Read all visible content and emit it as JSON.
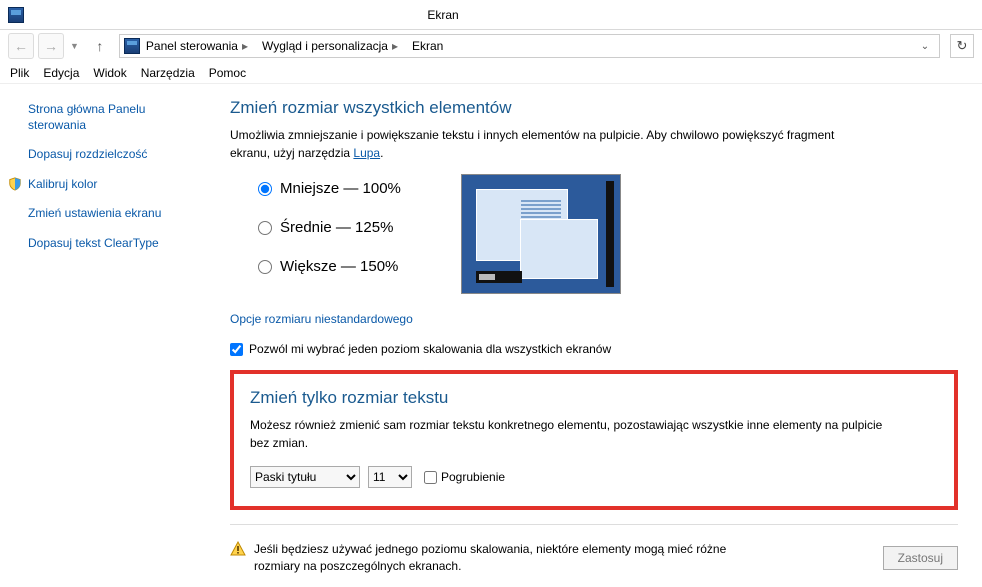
{
  "window": {
    "title": "Ekran"
  },
  "nav": {
    "crumbs": [
      "Panel sterowania",
      "Wygląd i personalizacja",
      "Ekran"
    ]
  },
  "menu": {
    "items": [
      "Plik",
      "Edycja",
      "Widok",
      "Narzędzia",
      "Pomoc"
    ]
  },
  "sidebar": {
    "items": [
      {
        "label": "Strona główna Panelu sterowania"
      },
      {
        "label": "Dopasuj rozdzielczość"
      },
      {
        "label": "Kalibruj kolor",
        "shield": true
      },
      {
        "label": "Zmień ustawienia ekranu"
      },
      {
        "label": "Dopasuj tekst ClearType"
      }
    ]
  },
  "main": {
    "section1_title": "Zmień rozmiar wszystkich elementów",
    "section1_desc_1": "Umożliwia zmniejszanie i powiększanie tekstu i innych elementów na pulpicie. Aby chwilowo powiększyć fragment ekranu, użyj narzędzia ",
    "section1_desc_link": "Lupa",
    "section1_desc_2": ".",
    "radios": [
      {
        "label": "Mniejsze — 100%",
        "checked": true
      },
      {
        "label": "Średnie — 125%",
        "checked": false
      },
      {
        "label": "Większe — 150%",
        "checked": false
      }
    ],
    "custom_link": "Opcje rozmiaru niestandardowego",
    "scaling_checkbox": {
      "label": "Pozwól mi wybrać jeden poziom skalowania dla wszystkich ekranów",
      "checked": true
    },
    "section2_title": "Zmień tylko rozmiar tekstu",
    "section2_desc": "Możesz również zmienić sam rozmiar tekstu konkretnego elementu, pozostawiając wszystkie inne elementy na pulpicie bez zmian.",
    "element_select": {
      "value": "Paski tytułu"
    },
    "size_select": {
      "value": "11"
    },
    "bold_checkbox": {
      "label": "Pogrubienie",
      "checked": false
    },
    "warning_text": "Jeśli będziesz używać jednego poziomu skalowania, niektóre elementy mogą mieć różne rozmiary na poszczególnych ekranach.",
    "apply_label": "Zastosuj"
  }
}
